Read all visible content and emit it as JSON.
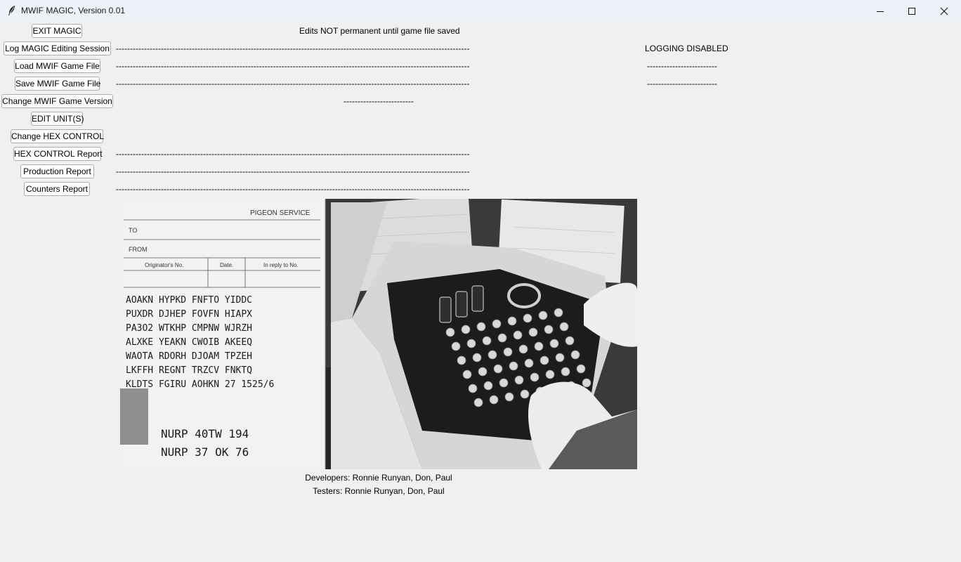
{
  "window": {
    "title": "MWIF MAGIC, Version 0.01",
    "icons": [
      "feather-icon",
      "minimize-icon",
      "maximize-icon",
      "close-icon"
    ]
  },
  "buttons": {
    "exit": "EXIT MAGIC",
    "log": "Log MAGIC Editing Session",
    "load": "Load MWIF Game File",
    "save": "Save MWIF Game File",
    "change_version": "Change MWIF Game Version",
    "edit_units": "EDIT UNIT(S)",
    "change_hex": "Change HEX CONTROL",
    "hex_report": "HEX CONTROL Report",
    "production_report": "Production Report",
    "counters_report": "Counters Report"
  },
  "status": {
    "edits_notice": "Edits NOT permanent until game file saved",
    "log_line": "------------------------------------------------------------------------------------------------------------------------------",
    "logging": "LOGGING DISABLED",
    "load_line": "------------------------------------------------------------------------------------------------------------------------------",
    "load_side": "--------------------------------",
    "save_line": "------------------------------------------------------------------------------------------------------------------------------",
    "save_side": "--------------------------------",
    "version_line": "--------------------------------",
    "hex_line": "------------------------------------------------------------------------------------------------------------------------------",
    "production_line": "------------------------------------------------------------------------------------------------------------------------------",
    "counters_line": "------------------------------------------------------------------------------------------------------------------------------"
  },
  "photo": {
    "form_header": "PIGEON SERVICE",
    "to_label": "TO",
    "from_label": "FROM",
    "col1": "Originator's No.",
    "col2": "Date.",
    "col3": "In reply to No.",
    "cipher_rows": [
      "AOAKN  HYPKD  FNFTO  YIDDC",
      "PUXDR  DJHEP  FOVFN  HIAPX",
      "PA3O2  WTKHP  CMPNW  WJRZH",
      "ALXKE  YEAKN  CWOIB  AKEEQ",
      "WAOTA  RDORH  DJOAM  TPZEH",
      "LKFFH  REGNT  TRZCV  FNKTQ",
      "KLDTS  FGIRU  AOHKN  27   1525/6"
    ],
    "footer_line1": "NURP 40TW 194",
    "footer_line2": "NURP 37 OK 76"
  },
  "credits": {
    "developers": "Developers: Ronnie Runyan, Don, Paul",
    "testers": "Testers: Ronnie Runyan, Don, Paul"
  }
}
